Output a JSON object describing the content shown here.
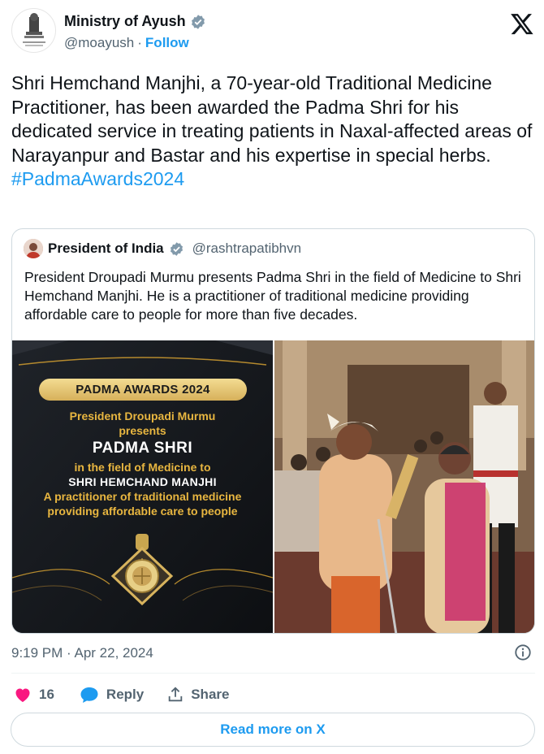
{
  "author": {
    "name": "Ministry of Ayush",
    "handle": "@moayush",
    "separator": "·",
    "follow_label": "Follow",
    "avatar_icon": "emblem-of-india-icon",
    "verified_icon": "verified-badge-icon"
  },
  "tweet": {
    "text": "Shri Hemchand Manjhi, a 70-year-old Traditional Medicine Practitioner, has been awarded the Padma Shri for his dedicated service in treating patients in Naxal-affected areas of Narayanpur and Bastar and his expertise in special herbs.",
    "hashtag": "#PadmaAwards2024"
  },
  "quote": {
    "name": "President of India",
    "handle": "@rashtrapatibhvn",
    "text": "President Droupadi Murmu presents Padma Shri in the field of Medicine to Shri Hemchand Manjhi. He is a practitioner of traditional medicine providing affordable care to people for more than five decades.",
    "poster": {
      "pill": "PADMA AWARDS 2024",
      "line1": "President Droupadi Murmu",
      "line2": "presents",
      "line3": "PADMA SHRI",
      "line4": "in the field of Medicine to",
      "line5": "SHRI HEMCHAND MANJHI",
      "line6": "A practitioner of traditional medicine",
      "line7": "providing affordable care to people"
    }
  },
  "footer": {
    "timestamp": "9:19 PM · Apr 22, 2024",
    "like_count": "16",
    "reply_label": "Reply",
    "share_label": "Share",
    "read_more_label": "Read more on X"
  },
  "colors": {
    "accent": "#1d9bf0",
    "like": "#f91880",
    "gold": "#e8b640"
  }
}
